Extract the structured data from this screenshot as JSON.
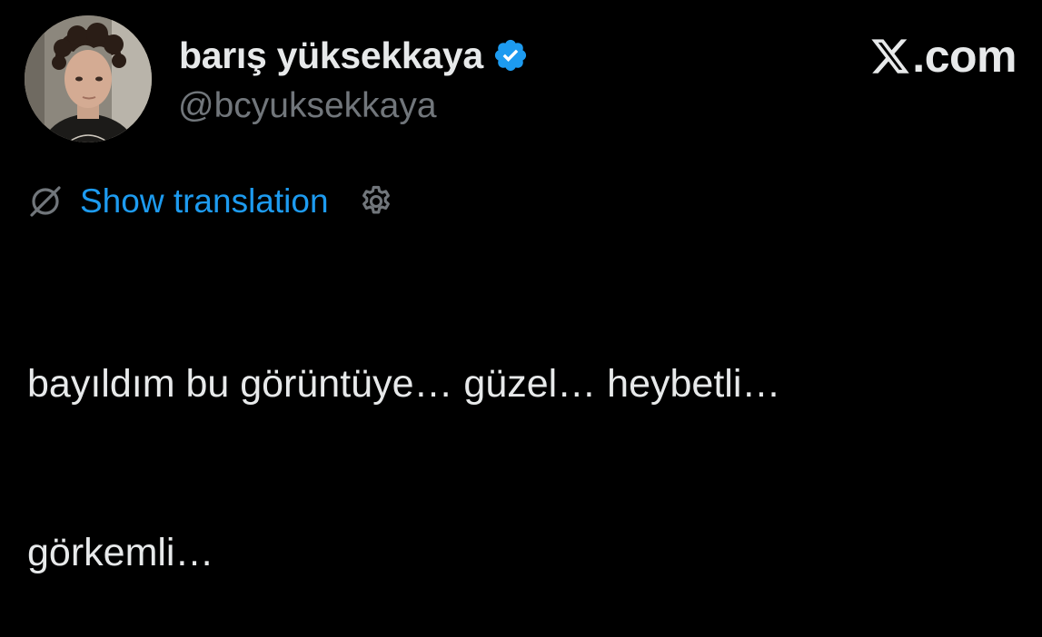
{
  "profile": {
    "display_name": "barış yüksekkaya",
    "handle": "@bcyuksekkaya",
    "verified_icon": "verified-badge-icon",
    "avatar": "avatar-photo"
  },
  "brand": {
    "logo_icon": "x-logo-icon",
    "text": ".com"
  },
  "translation": {
    "icon": "globe-slash-icon",
    "label": "Show translation",
    "settings_icon": "gear-icon"
  },
  "tweet": {
    "lines": [
      "bayıldım bu görüntüye… güzel… heybetli…",
      "görkemli…"
    ]
  },
  "colors": {
    "background": "#000000",
    "text_primary": "#e7e9ea",
    "text_secondary": "#71767b",
    "link": "#1d9bf0",
    "verified": "#1d9bf0"
  }
}
